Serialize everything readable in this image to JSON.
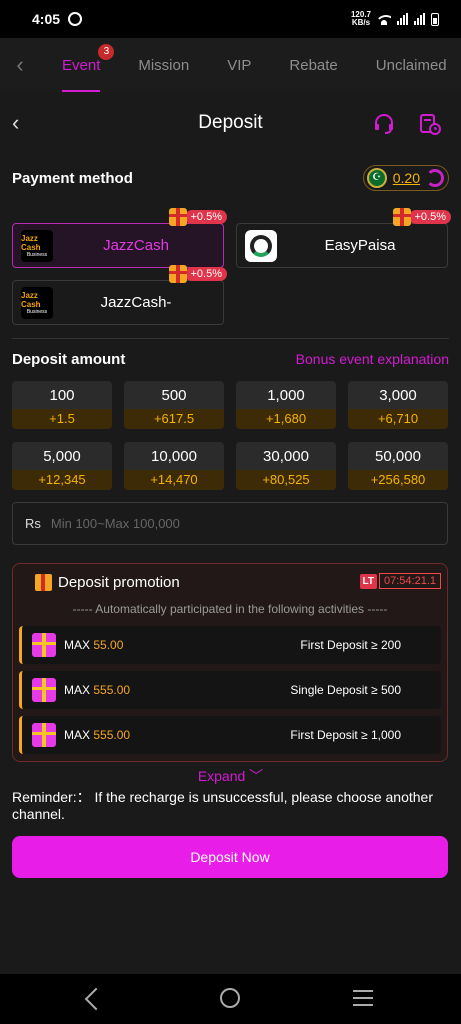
{
  "status": {
    "time": "4:05",
    "speed_top": "120.7",
    "speed_bottom": "KB/s"
  },
  "topnav": {
    "tabs": [
      {
        "label": "Event",
        "badge": "3",
        "active": true
      },
      {
        "label": "Mission"
      },
      {
        "label": "VIP"
      },
      {
        "label": "Rebate"
      },
      {
        "label": "Unclaimed"
      }
    ]
  },
  "header": {
    "title": "Deposit"
  },
  "payment": {
    "title": "Payment method",
    "balance": "0.20",
    "methods": [
      {
        "label": "JazzCash",
        "bonus": "+0.5%",
        "selected": true,
        "logo_top": "Jazz Cash",
        "logo_bottom": "Business"
      },
      {
        "label": "EasyPaisa",
        "bonus": "+0.5%"
      },
      {
        "label": "JazzCash-",
        "bonus": "+0.5%",
        "logo_top": "Jazz Cash",
        "logo_bottom": "Business"
      }
    ]
  },
  "deposit_amount": {
    "title": "Deposit amount",
    "link": "Bonus event explanation",
    "options": [
      {
        "value": "100",
        "bonus": "+1.5"
      },
      {
        "value": "500",
        "bonus": "+617.5"
      },
      {
        "value": "1,000",
        "bonus": "+1,680"
      },
      {
        "value": "3,000",
        "bonus": "+6,710"
      },
      {
        "value": "5,000",
        "bonus": "+12,345"
      },
      {
        "value": "10,000",
        "bonus": "+14,470"
      },
      {
        "value": "30,000",
        "bonus": "+80,525"
      },
      {
        "value": "50,000",
        "bonus": "+256,580"
      }
    ],
    "currency": "Rs",
    "placeholder": "Min 100~Max 100,000"
  },
  "promotion": {
    "title": "Deposit promotion",
    "lt": "LT",
    "timer": "07:54:21.1",
    "subtitle": "----- Automatically participated in the following activities -----",
    "max_label": "MAX",
    "rows": [
      {
        "max": "55.00",
        "condition": "First Deposit ≥ 200"
      },
      {
        "max": "555.00",
        "condition": "Single Deposit ≥ 500"
      },
      {
        "max": "555.00",
        "condition": "First Deposit ≥ 1,000"
      }
    ],
    "expand": "Expand ﹀"
  },
  "reminder": "Reminder:：  If the recharge is unsuccessful, please choose another channel.",
  "deposit_button": "Deposit Now",
  "colors": {
    "accent": "#e81ee8",
    "gold": "#f5b400",
    "panel": "#1a1a1a"
  }
}
